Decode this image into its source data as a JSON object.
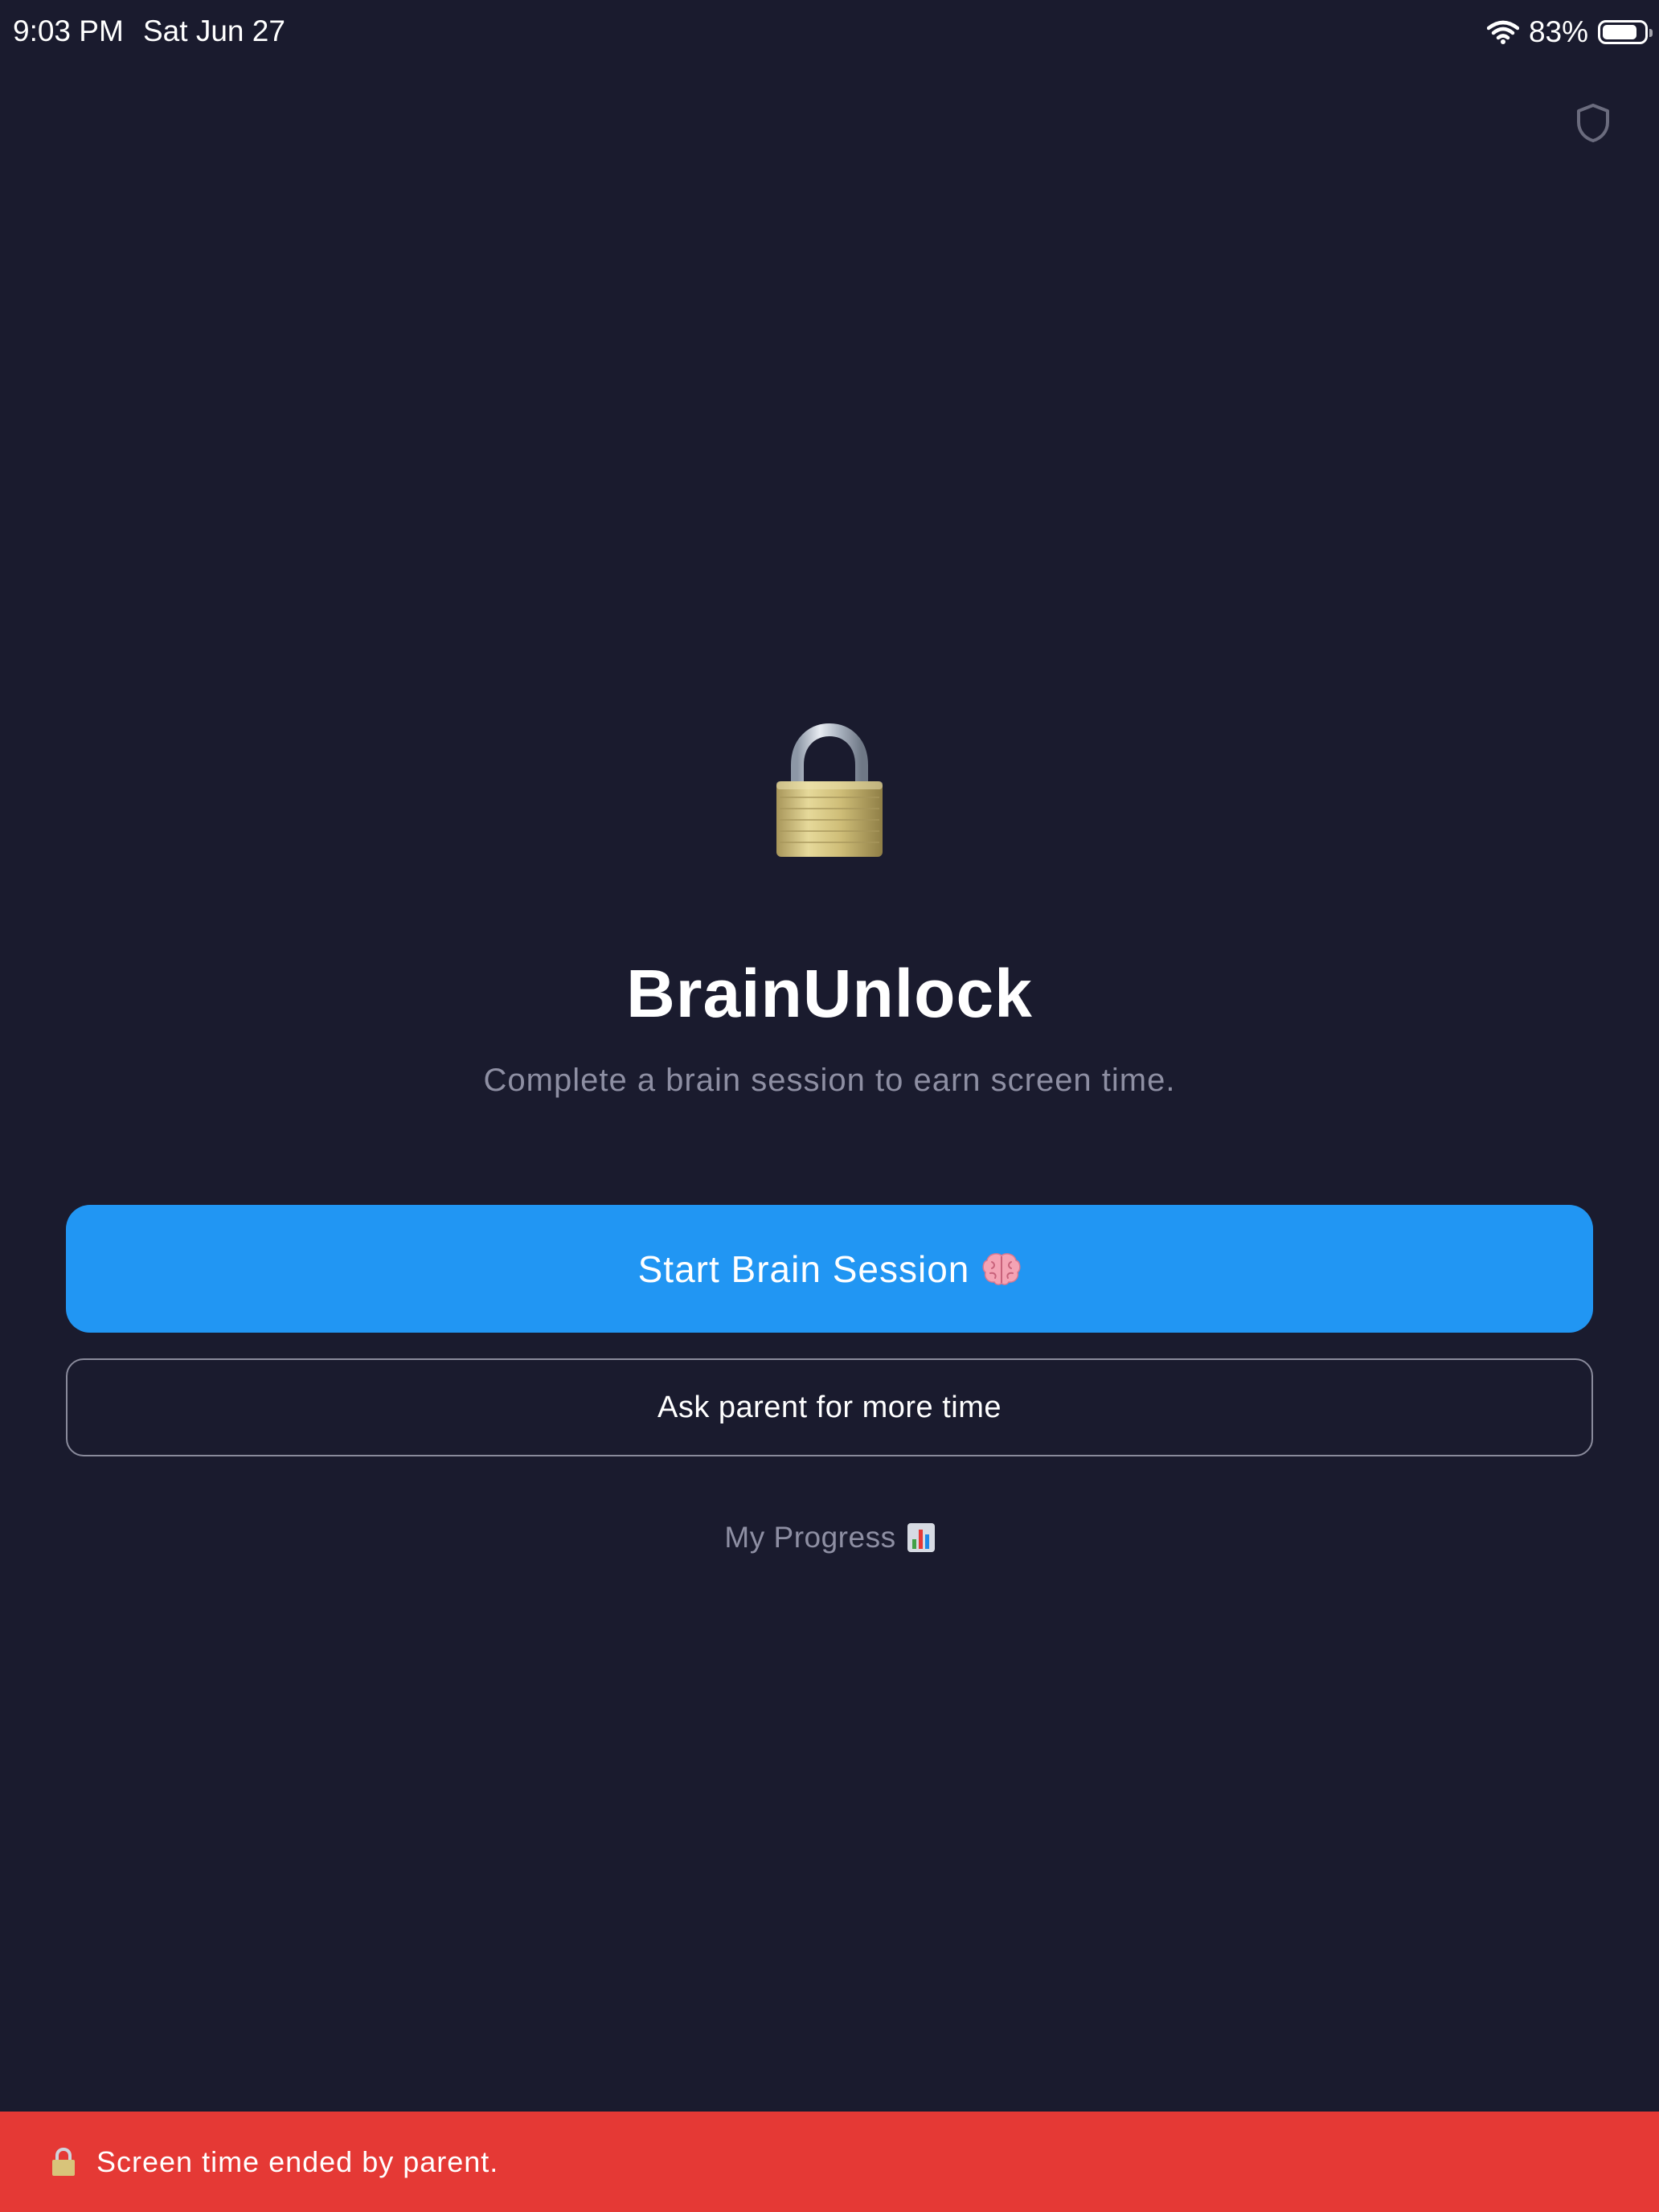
{
  "status_bar": {
    "time": "9:03 PM",
    "date": "Sat Jun 27",
    "battery_percent": "83%",
    "battery_level": 0.83,
    "wifi_icon": "wifi-icon",
    "battery_icon": "battery-icon"
  },
  "header": {
    "shield_icon": "shield-icon"
  },
  "hero": {
    "icon": "lock-icon",
    "title": "BrainUnlock",
    "subtitle": "Complete a brain session to earn screen time."
  },
  "actions": {
    "start_label": "Start Brain Session",
    "start_icon": "brain-icon",
    "ask_label": "Ask parent for more time",
    "progress_label": "My Progress",
    "progress_icon": "bar-chart-icon"
  },
  "banner": {
    "icon": "lock-icon",
    "text": "Screen time ended by parent."
  },
  "colors": {
    "background": "#1a1b2e",
    "primary_button": "#2196f3",
    "banner": "#e53935",
    "muted_text": "#8e8fa3"
  }
}
